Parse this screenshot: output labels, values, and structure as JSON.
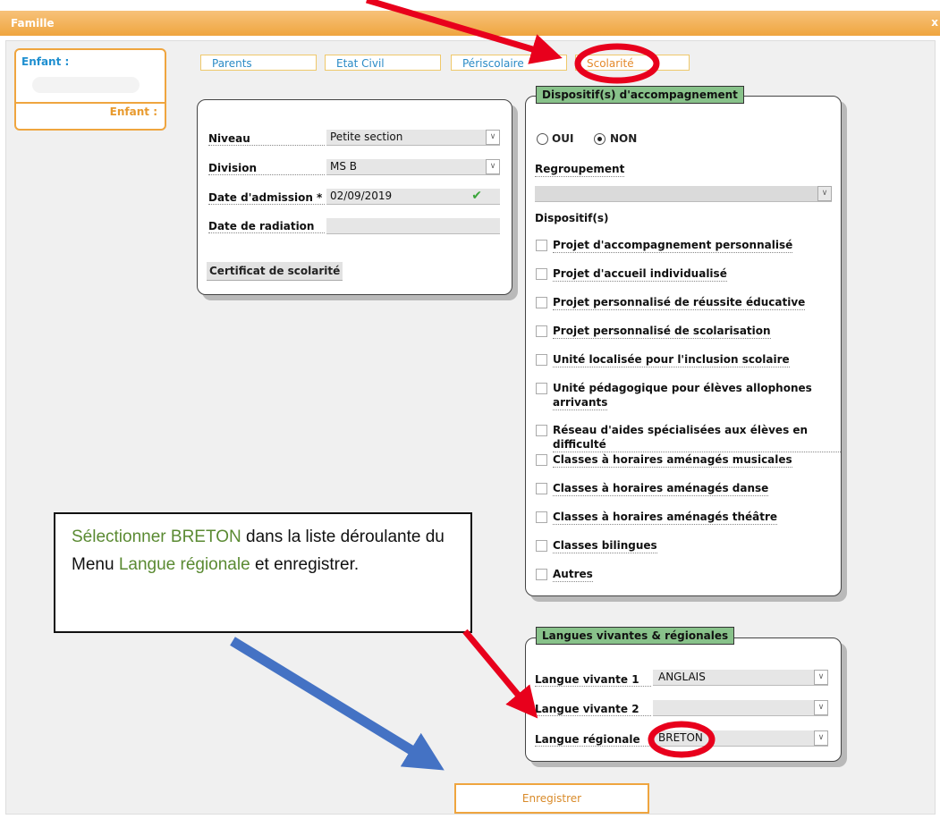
{
  "window": {
    "title": "Famille",
    "close_label": "x"
  },
  "child_panel": {
    "first_label": "Enfant :",
    "second_label": "Enfant :"
  },
  "tabs": [
    {
      "label": "Parents"
    },
    {
      "label": "Etat Civil"
    },
    {
      "label": "Périscolaire"
    },
    {
      "label": "Scolarité",
      "active": true
    }
  ],
  "school": {
    "niveau_label": "Niveau",
    "niveau_value": "Petite section",
    "division_label": "Division",
    "division_value": "MS B",
    "admission_label": "Date d'admission *",
    "admission_value": "02/09/2019",
    "radiation_label": "Date de radiation",
    "radiation_value": "",
    "certificate_button": "Certificat de scolarité"
  },
  "accompagnement": {
    "legend": "Dispositif(s) d'accompagnement",
    "oui_label": "OUI",
    "non_label": "NON",
    "selected": "NON",
    "regroupement_label": "Regroupement",
    "regroupement_value": "",
    "dispositifs_label": "Dispositif(s)",
    "items": [
      "Projet d'accompagnement personnalisé",
      "Projet d'accueil individualisé",
      "Projet personnalisé de réussite éducative",
      "Projet personnalisé de scolarisation",
      "Unité localisée pour l'inclusion scolaire",
      "Unité pédagogique pour élèves allophones",
      "Réseau d'aides spécialisées aux élèves en difficulté",
      "Classes à horaires aménagés musicales",
      "Classes à horaires aménagés danse",
      "Classes à horaires aménagés théâtre",
      "Classes bilingues",
      "Autres"
    ],
    "item6_line2": "arrivants"
  },
  "langues": {
    "legend": "Langues vivantes & régionales",
    "lv1_label": "Langue vivante 1",
    "lv1_value": "ANGLAIS",
    "lv2_label": "Langue vivante 2",
    "lv2_value": "",
    "regionale_label": "Langue régionale",
    "regionale_value": "BRETON"
  },
  "callout": {
    "part1": "Sélectionner BRETON",
    "part2": " dans la liste déroulante du Menu ",
    "part3": "Langue régionale",
    "part4": " et enregistrer."
  },
  "save_button": "Enregistrer",
  "colors": {
    "accent": "#efa53f",
    "legend_green": "#88c28a",
    "annotation_red": "#e8001c",
    "annotation_blue": "#4472c4"
  }
}
